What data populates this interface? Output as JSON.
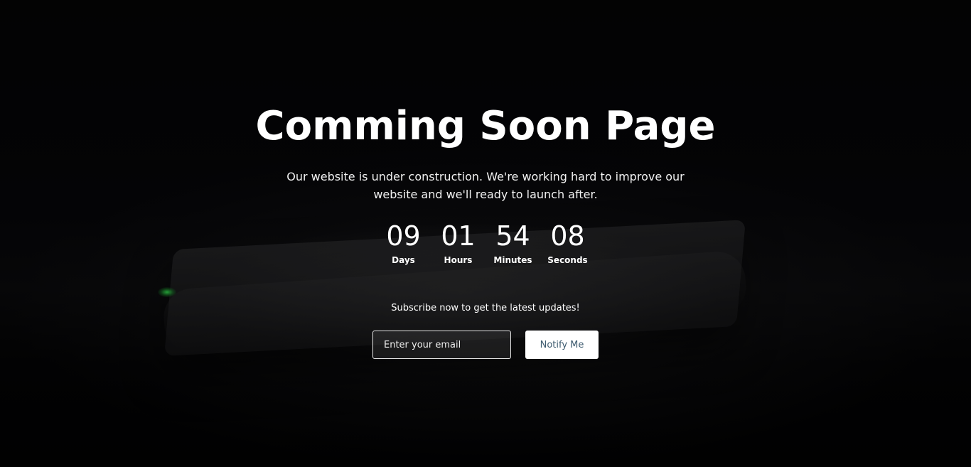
{
  "hero": {
    "title": "Comming Soon Page",
    "description": "Our website is under construction. We're working hard to improve our website and we'll ready to launch after."
  },
  "countdown": [
    {
      "value": "09",
      "label": "Days"
    },
    {
      "value": "01",
      "label": "Hours"
    },
    {
      "value": "54",
      "label": "Minutes"
    },
    {
      "value": "08",
      "label": "Seconds"
    }
  ],
  "subscribe": {
    "text": "Subscribe now to get the latest updates!",
    "email_placeholder": "Enter your email",
    "email_value": "",
    "button_label": "Notify Me"
  },
  "colors": {
    "background": "#030303",
    "text": "#ffffff",
    "button_text": "#3c5a6e",
    "led_accent": "#3cff5a"
  },
  "icons": {
    "background_image": "laptop-in-dark-image"
  }
}
